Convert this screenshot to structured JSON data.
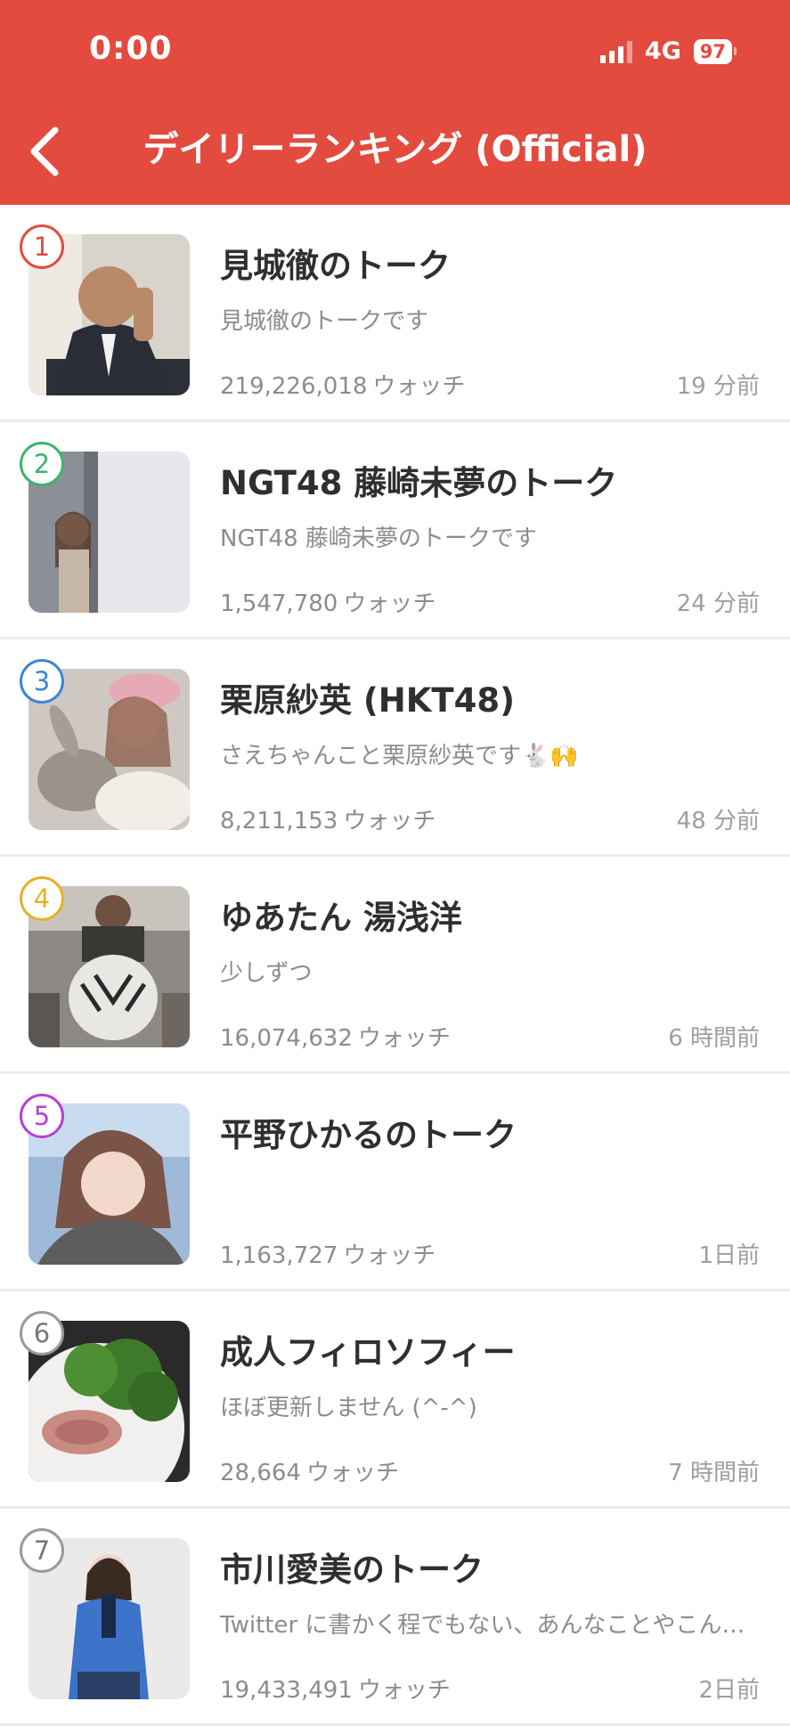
{
  "status_bar": {
    "time": "0:00",
    "network": "4G",
    "battery": "97"
  },
  "header": {
    "back_icon": "chevron-left-icon",
    "title": "デイリーランキング (Official)"
  },
  "colors": {
    "header_bg": "#e34b3f",
    "rank_1": "#e24c3f",
    "rank_2": "#3cb46e",
    "rank_3": "#3b86d6",
    "rank_4": "#e8b024",
    "rank_5": "#b83fd6",
    "rank_6": "#9a9a9a",
    "rank_7": "#9a9a9a"
  },
  "ranking": [
    {
      "rank": "1",
      "name": "見城徹のトーク",
      "description": "見城徹のトークです",
      "watch_count": "219,226,018",
      "watch_unit": "ウォッチ",
      "time_ago": "19 分前"
    },
    {
      "rank": "2",
      "name": "NGT48 藤崎未夢のトーク",
      "description": "NGT48 藤崎未夢のトークです",
      "watch_count": "1,547,780",
      "watch_unit": "ウォッチ",
      "time_ago": "24 分前"
    },
    {
      "rank": "3",
      "name": "栗原紗英 (HKT48)",
      "description": "さえちゃんこと栗原紗英です🐇🙌",
      "watch_count": "8,211,153",
      "watch_unit": "ウォッチ",
      "time_ago": "48 分前"
    },
    {
      "rank": "4",
      "name": "ゆあたん 湯浅洋",
      "description": "少しずつ",
      "watch_count": "16,074,632",
      "watch_unit": "ウォッチ",
      "time_ago": "6 時間前"
    },
    {
      "rank": "5",
      "name": "平野ひかるのトーク",
      "description": "",
      "watch_count": "1,163,727",
      "watch_unit": "ウォッチ",
      "time_ago": "1日前"
    },
    {
      "rank": "6",
      "name": "成人フィロソフィー",
      "description": "ほぼ更新しません (^-^)",
      "watch_count": "28,664",
      "watch_unit": "ウォッチ",
      "time_ago": "7 時間前"
    },
    {
      "rank": "7",
      "name": "市川愛美のトーク",
      "description": "Twitter に書かく程でもない、あんなことやこん…",
      "watch_count": "19,433,491",
      "watch_unit": "ウォッチ",
      "time_ago": "2日前"
    }
  ]
}
